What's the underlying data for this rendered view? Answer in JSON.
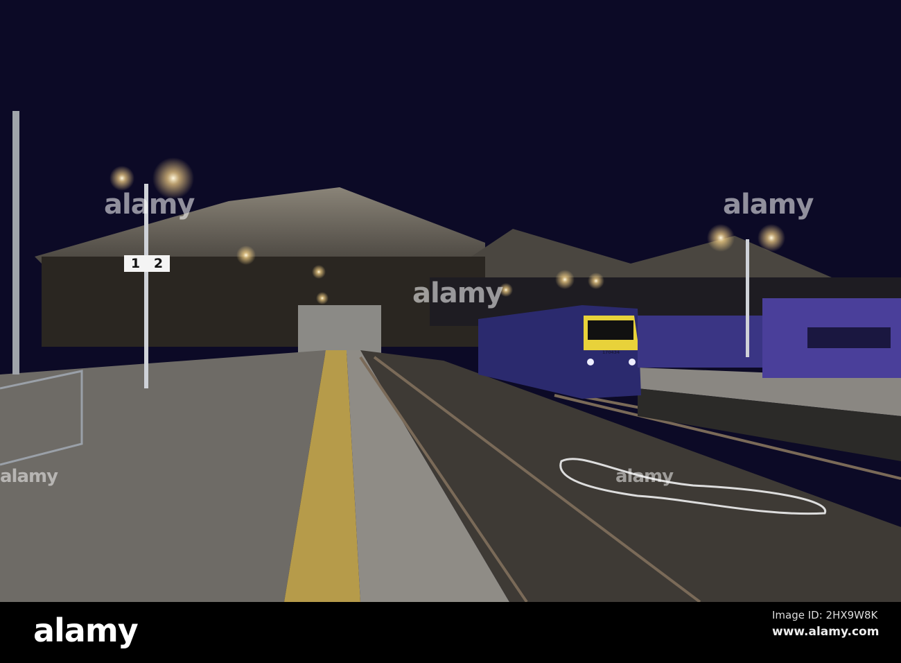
{
  "photo": {
    "platform_sign": {
      "left": "1",
      "right": "2"
    },
    "train_number": "170434",
    "watermark": "alamy",
    "colors": {
      "sky": "#0c0a26",
      "train_livery": "#2b2a6e",
      "train_cab": "#e8d23a",
      "platform": "#6e6b66"
    }
  },
  "footer": {
    "logo": "alamy",
    "image_id": "Image ID: 2HX9W8K",
    "url": "www.alamy.com"
  }
}
